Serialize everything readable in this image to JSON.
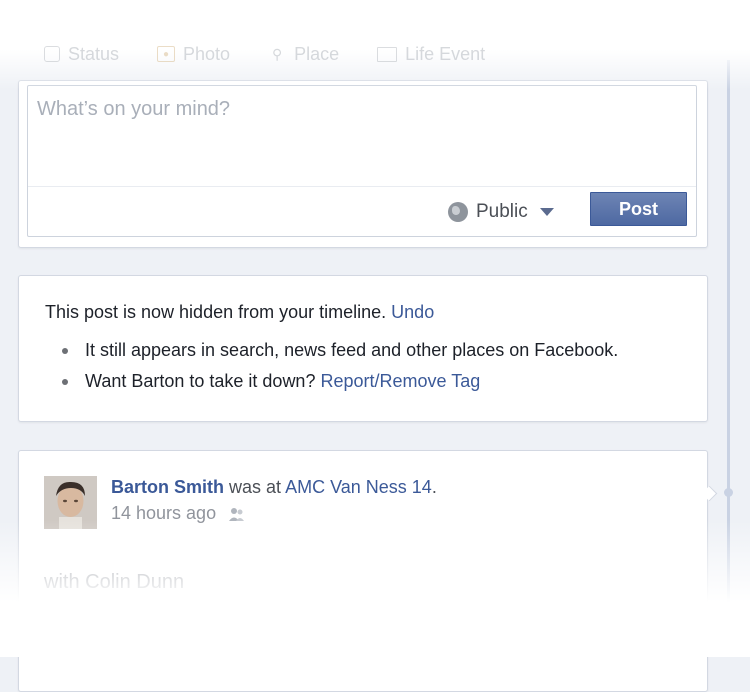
{
  "composer": {
    "tabs": [
      {
        "label": "Status",
        "icon": "status-icon"
      },
      {
        "label": "Photo",
        "icon": "photo-icon"
      },
      {
        "label": "Place",
        "icon": "place-icon"
      },
      {
        "label": "Life Event",
        "icon": "life-event-icon"
      }
    ],
    "placeholder": "What’s on your mind?",
    "audience_label": "Public",
    "post_label": "Post"
  },
  "hidden_notice": {
    "message": "This post is now hidden from your timeline.",
    "undo_label": "Undo",
    "bullet1": "It still appears in search, news feed and other places on Facebook.",
    "bullet2_prefix": "Want Barton to take it down?",
    "bullet2_link": "Report/Remove Tag"
  },
  "story": {
    "author": "Barton Smith",
    "action": "was at",
    "place": "AMC Van Ness 14",
    "time": "14 hours ago",
    "with_text": "with Colin Dunn"
  },
  "colors": {
    "link": "#3b5998",
    "post_button": "#4e69a2",
    "page_background": "#eef1f6"
  }
}
